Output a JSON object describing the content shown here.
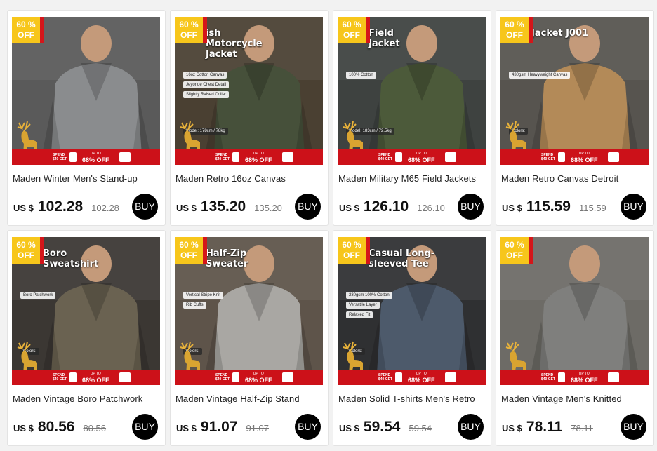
{
  "colors": {
    "badge": "#f7c61b",
    "promo": "#cc1119",
    "buy": "#000000"
  },
  "products": [
    {
      "discount": "60 %\nOFF",
      "heading": "",
      "chips": [],
      "title": "Maden Winter Men's Stand-up",
      "currency": "US $",
      "price": "102.28",
      "original": "102.28",
      "buy": "BUY",
      "promo_small": "SPEND $40 GET",
      "promo_off": "68% OFF",
      "promo_upto": "UP TO",
      "bg": "#5a5a5a",
      "garment": "#8a8c8e"
    },
    {
      "discount": "60 %\nOFF",
      "heading": "ish\nMotorcycle\nJacket",
      "chips": [
        "16oz Cotton Canvas",
        "Jeyonde Chest Detail",
        "Slightly Raised Collar"
      ],
      "size_chip": "Model: 178cm / 78kg",
      "title": "Maden Retro 16oz Canvas",
      "currency": "US $",
      "price": "135.20",
      "original": "135.20",
      "buy": "BUY",
      "promo_small": "SPEND $40 GET",
      "promo_off": "68% OFF",
      "promo_upto": "UP TO",
      "bg": "#4a4032",
      "garment": "#46503a"
    },
    {
      "discount": "60 %\nOFF",
      "heading": "Field\nJacket",
      "chips": [
        "100% Cotton"
      ],
      "size_chip": "Model: 183cm / 72.5kg",
      "title": "Maden Military M65 Field Jackets",
      "currency": "US $",
      "price": "126.10",
      "original": "126.10",
      "buy": "BUY",
      "promo_small": "SPEND $40 GET",
      "promo_off": "68% OFF",
      "promo_upto": "UP TO",
      "bg": "#3e4240",
      "garment": "#4c5a3a"
    },
    {
      "discount": "60 %\nOFF",
      "heading": "Jacket J001",
      "chips": [
        "430gsm Heavyweight Canvas"
      ],
      "size_chip": "Colors:",
      "title": "Maden Retro Canvas Detroit",
      "currency": "US $",
      "price": "115.59",
      "original": "115.59",
      "buy": "BUY",
      "promo_small": "SPEND $40 GET",
      "promo_off": "68% OFF",
      "promo_upto": "UP TO",
      "bg": "#57544f",
      "garment": "#b38a58"
    },
    {
      "discount": "60 %\nOFF",
      "heading": "Boro\nSweatshirt",
      "chips": [
        "Boro Patchwork"
      ],
      "size_chip": "Colors:",
      "title": "Maden Vintage Boro Patchwork",
      "currency": "US $",
      "price": "80.56",
      "original": "80.56",
      "buy": "BUY",
      "promo_small": "SPEND $40 GET",
      "promo_off": "68% OFF",
      "promo_upto": "UP TO",
      "bg": "#3b3733",
      "garment": "#6a6251"
    },
    {
      "discount": "60 %\nOFF",
      "heading": "Half-Zip\nSweater",
      "chips": [
        "Vertical Stripe Knit",
        "Rib Cuffs"
      ],
      "size_chip": "Colors:",
      "title": "Maden Vintage Half-Zip Stand",
      "currency": "US $",
      "price": "91.07",
      "original": "91.07",
      "buy": "BUY",
      "promo_small": "SPEND $40 GET",
      "promo_off": "68% OFF",
      "promo_upto": "UP TO",
      "bg": "#5e544a",
      "garment": "#a9a7a3"
    },
    {
      "discount": "60 %\nOFF",
      "heading": "Casual Long-\nsleeved Tee",
      "chips": [
        "230gsm 100% Cotton",
        "Versatile Layer",
        "Relaxed Fit"
      ],
      "size_chip": "Colors:",
      "title": "Maden Solid T-shirts Men's Retro",
      "currency": "US $",
      "price": "59.54",
      "original": "59.54",
      "buy": "BUY",
      "promo_small": "SPEND $40 GET",
      "promo_off": "68% OFF",
      "promo_upto": "UP TO",
      "bg": "#2f3032",
      "garment": "#4d5a6b"
    },
    {
      "discount": "60 %\nOFF",
      "heading": "",
      "chips": [],
      "title": "Maden Vintage Men's Knitted",
      "currency": "US $",
      "price": "78.11",
      "original": "78.11",
      "buy": "BUY",
      "promo_small": "SPEND $40 GET",
      "promo_off": "68% OFF",
      "promo_upto": "UP TO",
      "bg": "#6d6b66",
      "garment": "#7f7f7d"
    }
  ]
}
